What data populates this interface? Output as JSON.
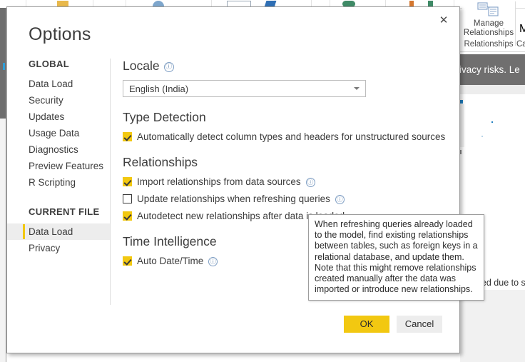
{
  "background": {
    "ribbon": {
      "manage_relationships_label_line1": "Manage",
      "manage_relationships_label_line2": "Relationships",
      "group_title": "Relationships",
      "next_group_title": "Ca",
      "next_group_label": "M"
    },
    "privacy_banner_text": "privacy risks. Le",
    "canvas_notice_text": "displayed due to security"
  },
  "dialog": {
    "title": "Options",
    "close_label": "✕",
    "sidebar": {
      "sections": [
        {
          "header": "GLOBAL",
          "items": [
            {
              "label": "Data Load",
              "selected": false
            },
            {
              "label": "Security",
              "selected": false
            },
            {
              "label": "Updates",
              "selected": false
            },
            {
              "label": "Usage Data",
              "selected": false
            },
            {
              "label": "Diagnostics",
              "selected": false
            },
            {
              "label": "Preview Features",
              "selected": false
            },
            {
              "label": "R Scripting",
              "selected": false
            }
          ]
        },
        {
          "header": "CURRENT FILE",
          "items": [
            {
              "label": "Data Load",
              "selected": true
            },
            {
              "label": "Privacy",
              "selected": false
            }
          ]
        }
      ]
    },
    "content": {
      "locale": {
        "title": "Locale",
        "info": "ⓘ",
        "selected_value": "English (India)"
      },
      "type_detection": {
        "title": "Type Detection",
        "checkbox_label": "Automatically detect column types and headers for unstructured sources",
        "checked": true
      },
      "relationships": {
        "title": "Relationships",
        "items": [
          {
            "label": "Import relationships from data sources",
            "checked": true,
            "has_info": true
          },
          {
            "label": "Update relationships when refreshing queries",
            "checked": false,
            "has_info": true
          },
          {
            "label": "Autodetect new relationships after data is loaded",
            "checked": true,
            "has_info": false
          }
        ]
      },
      "time_intelligence": {
        "title": "Time Intelligence",
        "items": [
          {
            "label": "Auto Date/Time",
            "checked": true,
            "has_info": true
          }
        ]
      }
    },
    "buttons": {
      "ok": "OK",
      "cancel": "Cancel"
    },
    "tooltip": {
      "text": "When refreshing queries already loaded to the model, find existing relationships between tables, such as foreign keys in a relational database, and update them. Note that this might remove relationships created manually after the data was imported or introduce new relationships."
    }
  },
  "colors": {
    "accent_yellow": "#F2C811",
    "banner_gray": "#706F6F",
    "selected_item_bg": "#EDEDED"
  }
}
